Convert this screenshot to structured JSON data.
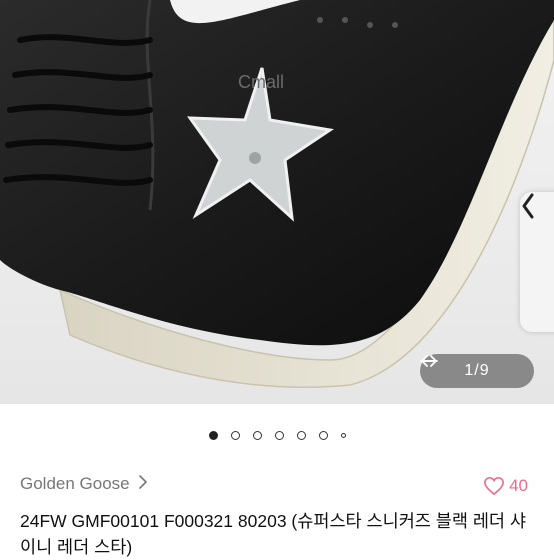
{
  "product": {
    "image": {
      "watermark": "Cmall",
      "pager": {
        "current": "1",
        "total": "9",
        "text": "1/9"
      }
    },
    "carousel": {
      "total_dots": 7,
      "active_index": 0
    },
    "brand": {
      "name": "Golden Goose",
      "chevron": "chevron-right-icon"
    },
    "likes": {
      "count": "40",
      "icon": "heart-outline-icon"
    },
    "title": "24FW   GMF00101 F000321 80203 (슈퍼스타 스니커즈 블랙 레더 샤이니 레더 스타)"
  },
  "colors": {
    "accent": "#f06a8a",
    "text": "#111111",
    "muted": "#777777"
  }
}
